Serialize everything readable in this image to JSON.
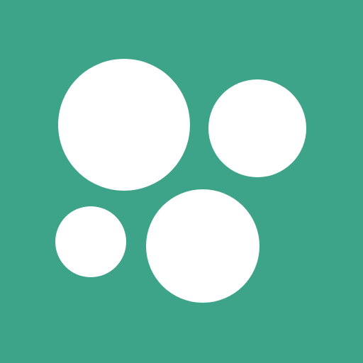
{
  "colors": {
    "background": "#3DA48A",
    "circle_fill": "#FFFFFF"
  },
  "circles": [
    {
      "name": "circle-large-top-left"
    },
    {
      "name": "circle-medium-top-right"
    },
    {
      "name": "circle-small-bottom-left"
    },
    {
      "name": "circle-large-bottom-center"
    }
  ]
}
